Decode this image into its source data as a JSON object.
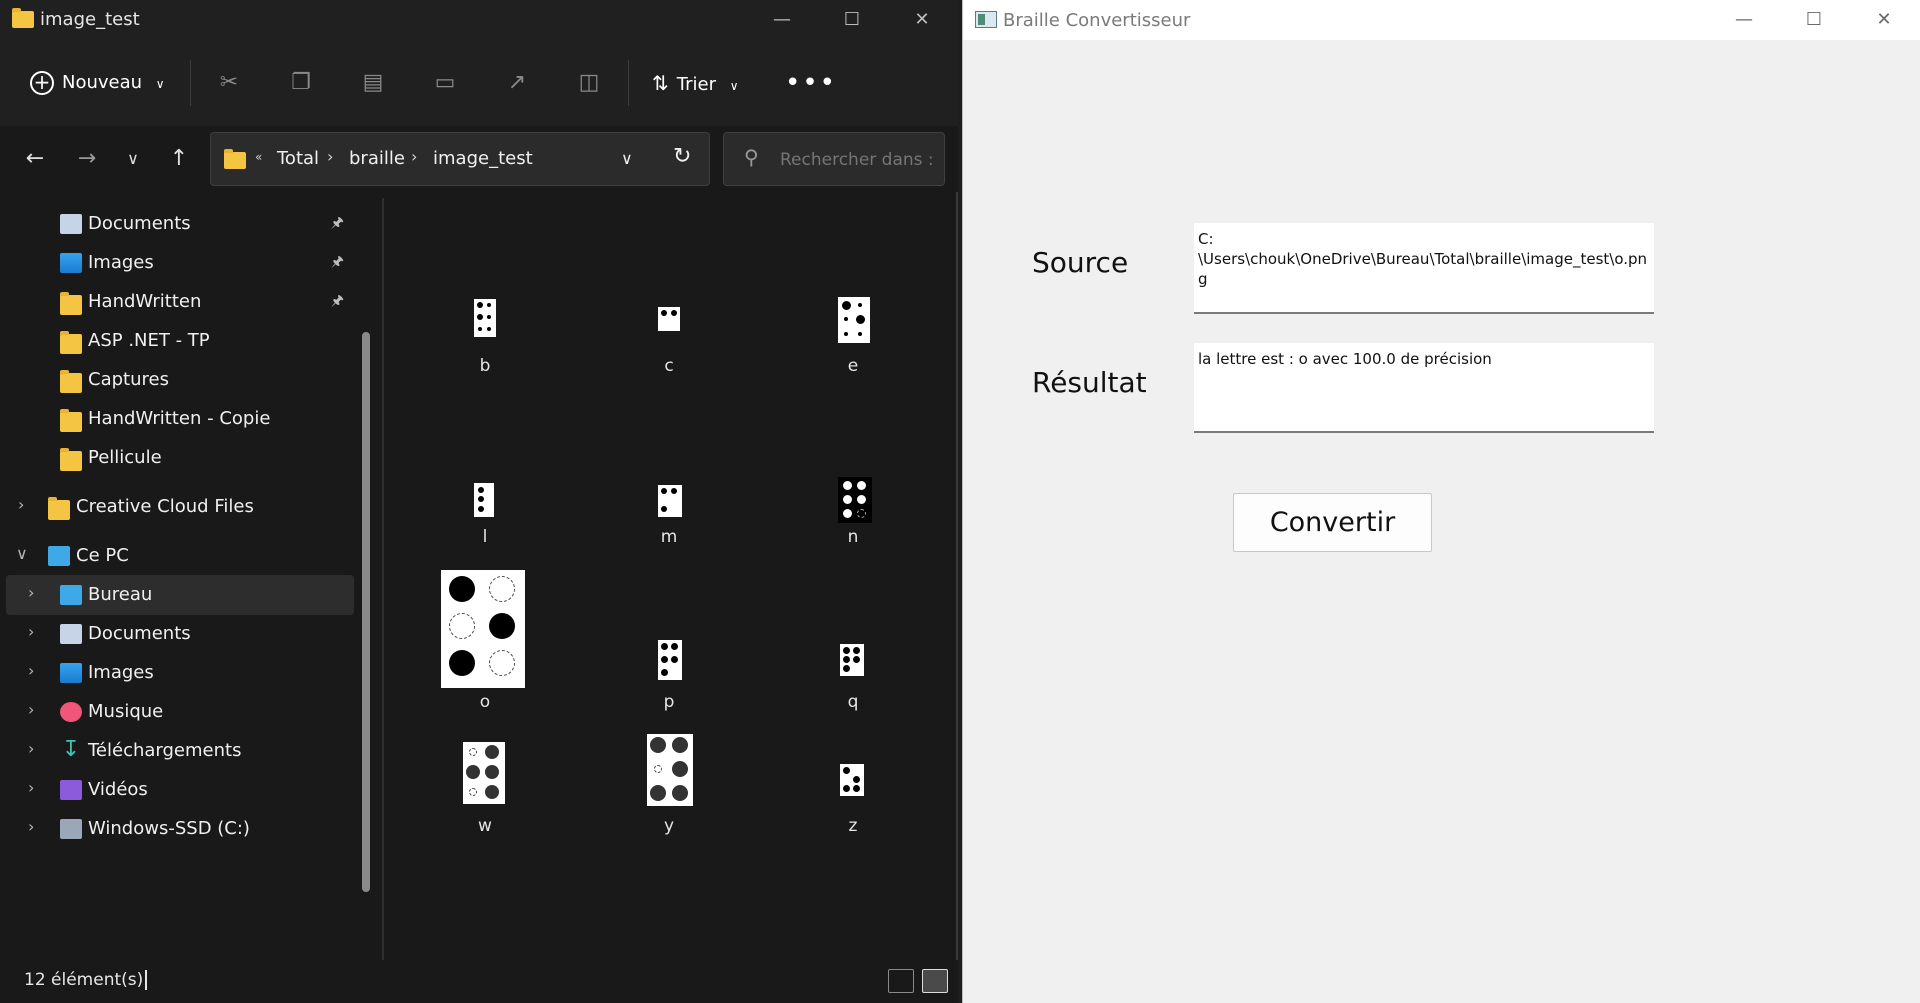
{
  "explorer": {
    "title": "image_test",
    "toolbar": {
      "new_label": "Nouveau",
      "sort_label": "Trier"
    },
    "breadcrumbs": [
      "Total",
      "braille",
      "image_test"
    ],
    "search_placeholder": "Rechercher dans : i...",
    "sidebar": {
      "pinned": [
        {
          "label": "Documents",
          "icon": "documents-icon"
        },
        {
          "label": "Images",
          "icon": "images-icon"
        },
        {
          "label": "HandWritten",
          "icon": "folder-icon"
        },
        {
          "label": "ASP .NET - TP",
          "icon": "folder-icon"
        },
        {
          "label": "Captures",
          "icon": "folder-icon"
        },
        {
          "label": "HandWritten - Copie",
          "icon": "folder-icon"
        },
        {
          "label": "Pellicule",
          "icon": "folder-icon"
        }
      ],
      "creative_cloud": "Creative Cloud Files",
      "this_pc": "Ce PC",
      "pc_items": [
        {
          "label": "Bureau",
          "icon": "desktop-icon"
        },
        {
          "label": "Documents",
          "icon": "documents-icon"
        },
        {
          "label": "Images",
          "icon": "images-icon"
        },
        {
          "label": "Musique",
          "icon": "music-icon"
        },
        {
          "label": "Téléchargements",
          "icon": "download-icon"
        },
        {
          "label": "Vidéos",
          "icon": "videos-icon"
        },
        {
          "label": "Windows-SSD (C:)",
          "icon": "drive-icon"
        }
      ]
    },
    "files": [
      "b",
      "c",
      "e",
      "l",
      "m",
      "n",
      "o",
      "p",
      "q",
      "w",
      "y",
      "z"
    ],
    "status": "12 élément(s)"
  },
  "app": {
    "title": "Braille Convertisseur",
    "source_label": "Source",
    "source_value": "C:\n\\Users\\chouk\\OneDrive\\Bureau\\Total\\braille\\image_test\\o.png",
    "result_label": "Résultat",
    "result_value": "la lettre est : o avec 100.0 de précision",
    "convert_label": "Convertir"
  }
}
